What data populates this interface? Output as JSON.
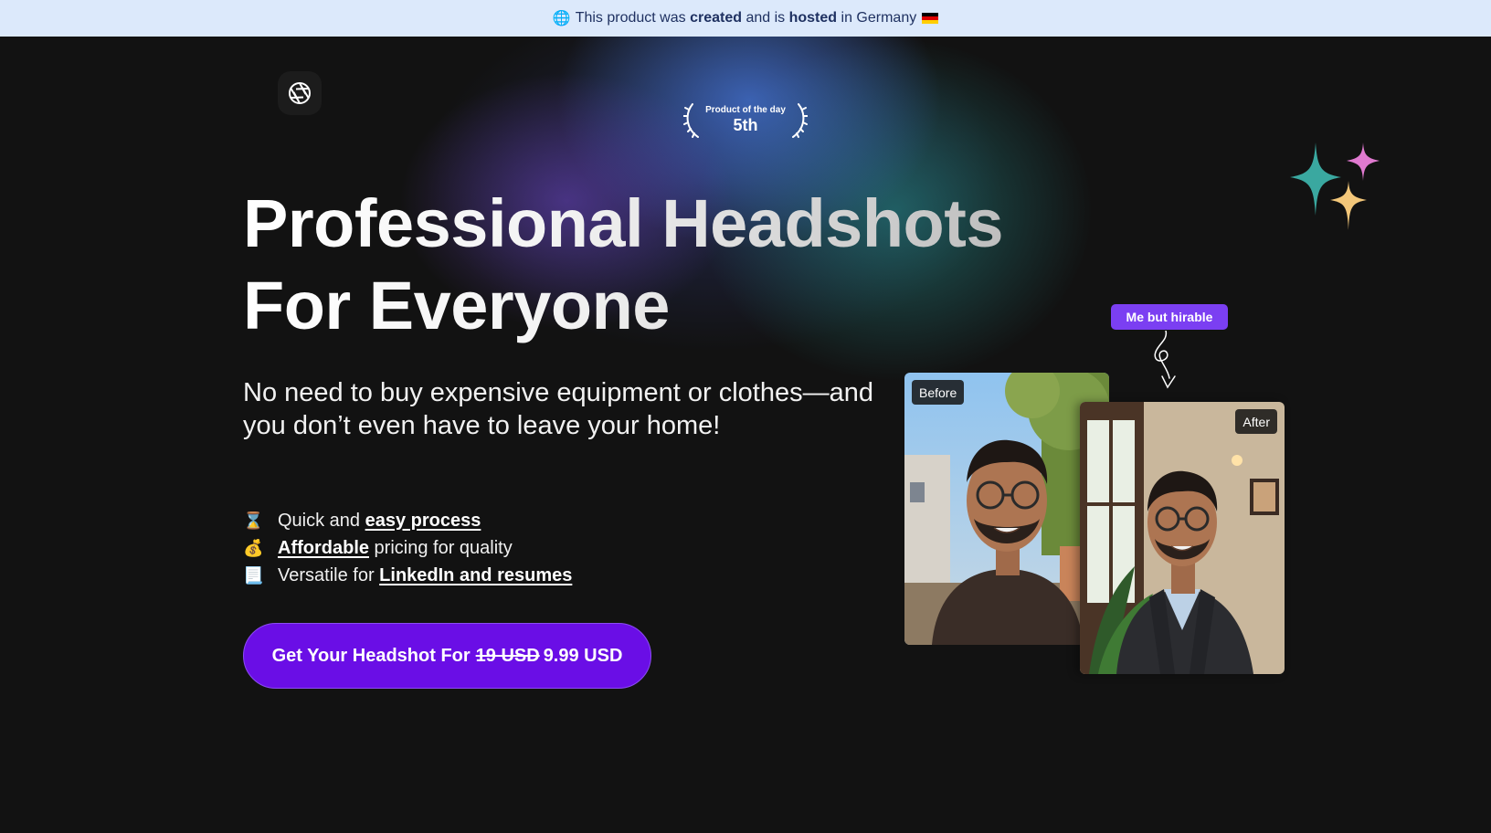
{
  "banner": {
    "text_1": "This product was",
    "bold_1": "created",
    "text_2": "and is",
    "bold_2": "hosted",
    "text_3": "in Germany"
  },
  "award": {
    "label": "Product of the day",
    "rank": "5th"
  },
  "hero": {
    "headline_line1": "Professional Headshots",
    "headline_line2": "For Everyone",
    "subtitle": "No need to buy expensive equipment or clothes—and you don’t even have to leave your home!"
  },
  "features": [
    {
      "icon": "hourglass-icon",
      "emoji": "⌛",
      "pre": "Quick and ",
      "link": "easy process",
      "post": ""
    },
    {
      "icon": "money-bag-icon",
      "emoji": "💰",
      "pre": "",
      "link": "Affordable",
      "post": " pricing for quality"
    },
    {
      "icon": "scroll-icon",
      "emoji": "📃",
      "pre": "Versatile for ",
      "link": "LinkedIn and resumes",
      "post": ""
    }
  ],
  "cta": {
    "prefix": "Get Your Headshot For",
    "old_price": "19 USD",
    "new_price": "9.99 USD"
  },
  "showcase": {
    "callout": "Me but hirable",
    "before_label": "Before",
    "after_label": "After"
  },
  "colors": {
    "banner_bg": "#dce9fb",
    "banner_text": "#1f3161",
    "cta_bg": "#6a0ee6",
    "callout_bg": "#7b3ff2",
    "sparkle_teal": "#3aa8a0",
    "sparkle_pink": "#e07ad0",
    "sparkle_gold": "#f3c77a"
  }
}
